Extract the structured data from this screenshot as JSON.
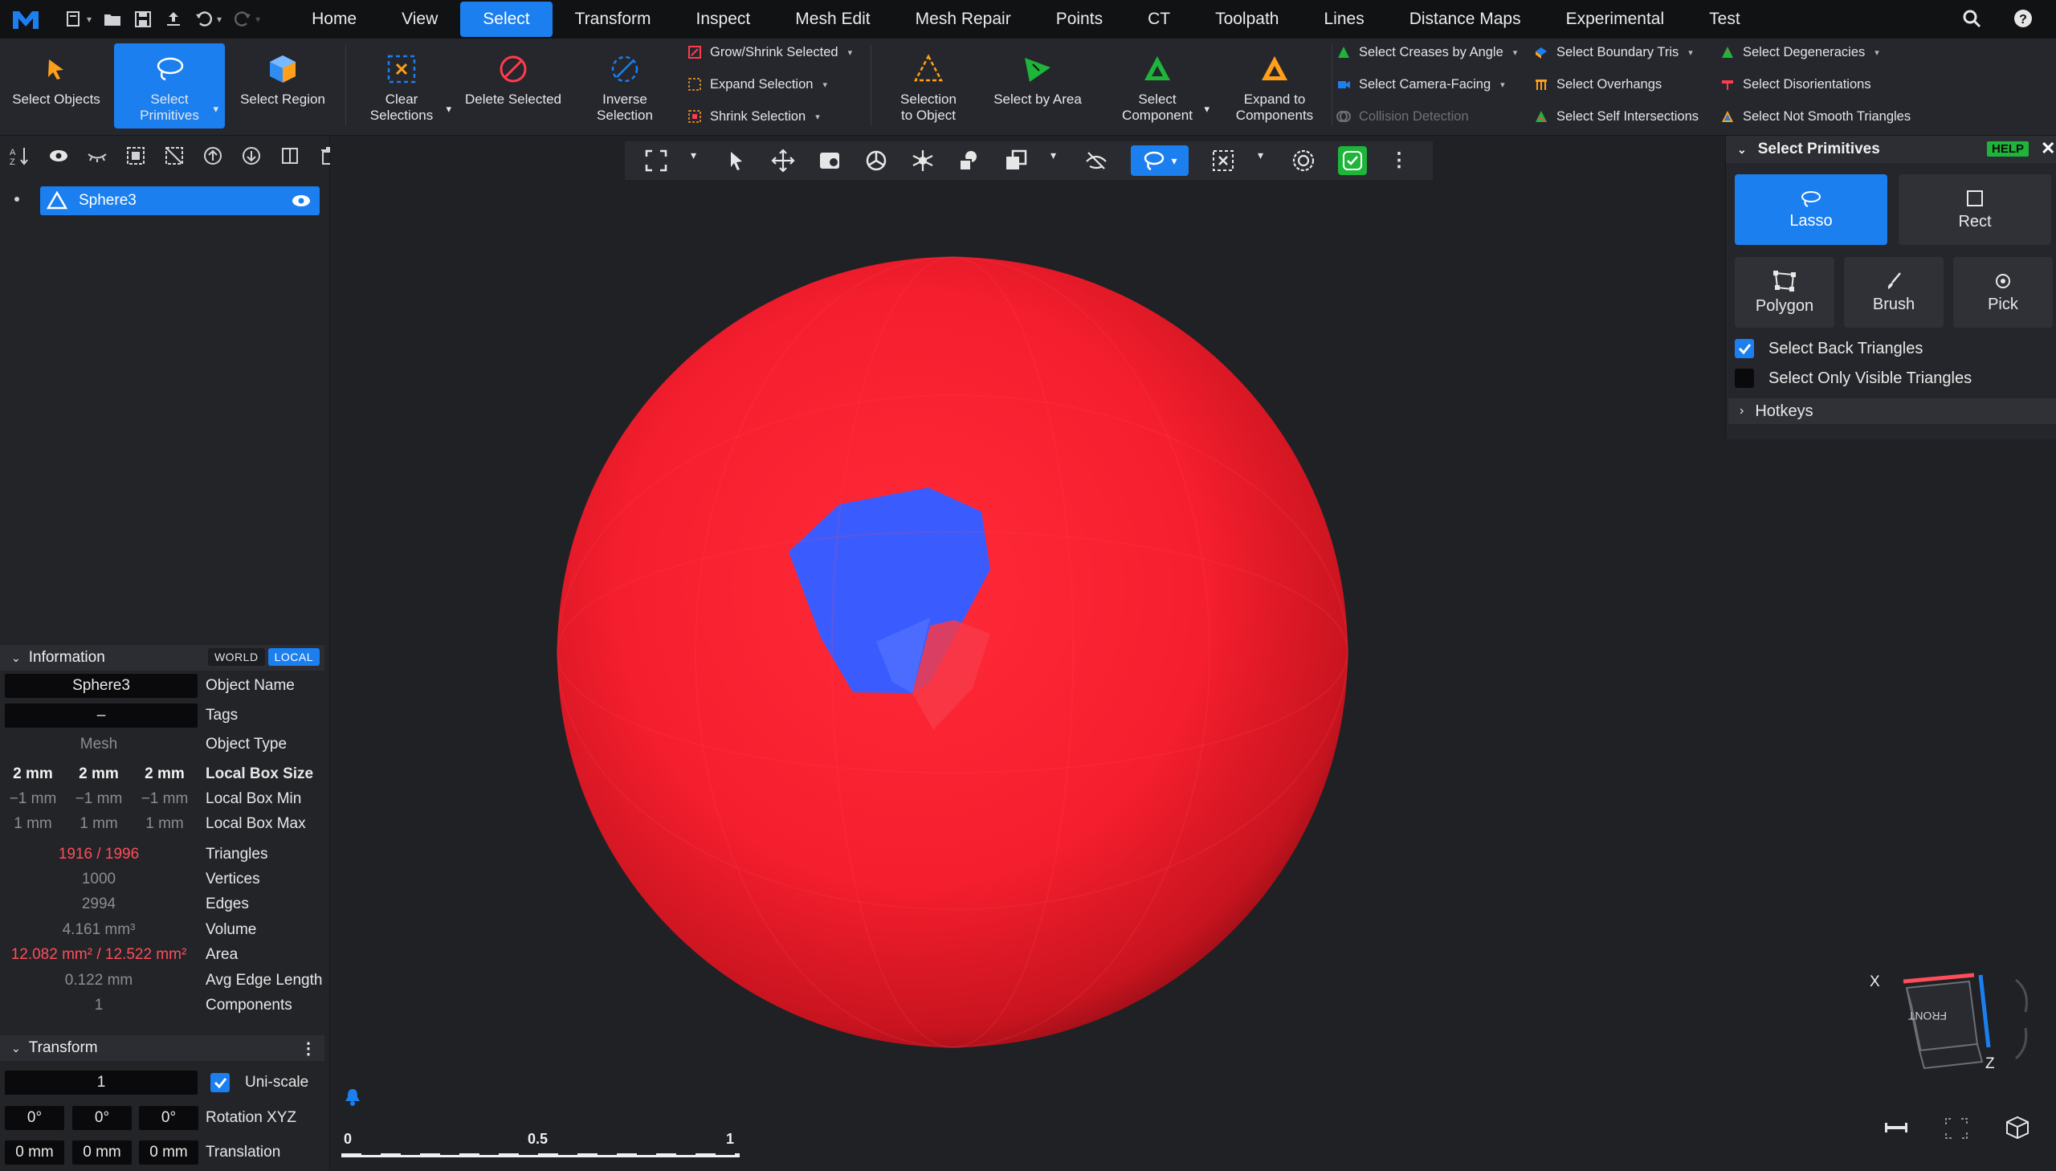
{
  "menubar": {
    "tabs": [
      "Home",
      "View",
      "Select",
      "Transform",
      "Inspect",
      "Mesh Edit",
      "Mesh Repair",
      "Points",
      "CT",
      "Toolpath",
      "Lines",
      "Distance Maps",
      "Experimental",
      "Test"
    ],
    "active_tab": "Select"
  },
  "ribbon": {
    "select_objects": "Select Objects",
    "select_primitives_1": "Select",
    "select_primitives_2": "Primitives",
    "select_region": "Select Region",
    "clear_1": "Clear",
    "clear_2": "Selections",
    "delete_selected": "Delete Selected",
    "inverse_1": "Inverse",
    "inverse_2": "Selection",
    "grow_shrink": "Grow/Shrink Selected",
    "expand_selection": "Expand Selection",
    "shrink_selection": "Shrink Selection",
    "sel_to_obj_1": "Selection",
    "sel_to_obj_2": "to Object",
    "select_by_area": "Select by Area",
    "select_component_1": "Select",
    "select_component_2": "Component",
    "expand_components_1": "Expand to",
    "expand_components_2": "Components",
    "creases": "Select Creases by Angle",
    "camera_facing": "Select Camera-Facing",
    "collision": "Collision Detection",
    "boundary_tris": "Select Boundary Tris",
    "overhangs": "Select Overhangs",
    "self_intersections": "Select Self Intersections",
    "degeneracies": "Select Degeneracies",
    "disorientations": "Select Disorientations",
    "not_smooth": "Select Not Smooth Triangles"
  },
  "scene": {
    "object_name": "Sphere3"
  },
  "information": {
    "title": "Information",
    "world": "WORLD",
    "local": "LOCAL",
    "object_name_value": "Sphere3",
    "object_name_label": "Object Name",
    "tags_value": "–",
    "tags_label": "Tags",
    "object_type_value": "Mesh",
    "object_type_label": "Object Type",
    "box_size": [
      "2 mm",
      "2 mm",
      "2 mm"
    ],
    "box_size_label": "Local Box Size",
    "box_min": [
      "−1 mm",
      "−1 mm",
      "−1 mm"
    ],
    "box_min_label": "Local Box Min",
    "box_max": [
      "1 mm",
      "1 mm",
      "1 mm"
    ],
    "box_max_label": "Local Box Max",
    "triangles_value": "1916 / 1996",
    "triangles_label": "Triangles",
    "vertices_value": "1000",
    "vertices_label": "Vertices",
    "edges_value": "2994",
    "edges_label": "Edges",
    "volume_value": "4.161 mm³",
    "volume_label": "Volume",
    "area_value": "12.082 mm² / 12.522 mm²",
    "area_label": "Area",
    "avg_edge_value": "0.122 mm",
    "avg_edge_label": "Avg Edge Length",
    "components_value": "1",
    "components_label": "Components"
  },
  "transform": {
    "title": "Transform",
    "scale_value": "1",
    "uniscale_label": "Uni-scale",
    "rotation": [
      "0°",
      "0°",
      "0°"
    ],
    "rotation_label": "Rotation XYZ",
    "translation": [
      "0 mm",
      "0 mm",
      "0 mm"
    ],
    "translation_label": "Translation"
  },
  "select_primitives": {
    "title": "Select Primitives",
    "help": "HELP",
    "modes": [
      "Lasso",
      "Rect",
      "Polygon",
      "Brush",
      "Pick"
    ],
    "active_mode": "Lasso",
    "select_back_triangles": "Select Back Triangles",
    "select_back_checked": true,
    "select_only_visible": "Select Only Visible Triangles",
    "select_only_visible_checked": false,
    "hotkeys": "Hotkeys"
  },
  "scale_bar": {
    "labels": [
      "0",
      "0.5",
      "1"
    ]
  },
  "axes": {
    "x": "X",
    "z": "Z",
    "cube_face": "FRONT"
  },
  "colors": {
    "accent": "#1b7ff0",
    "mesh": "#ff1f2e",
    "selection": "#3a5cff",
    "green": "#1eb53a"
  }
}
